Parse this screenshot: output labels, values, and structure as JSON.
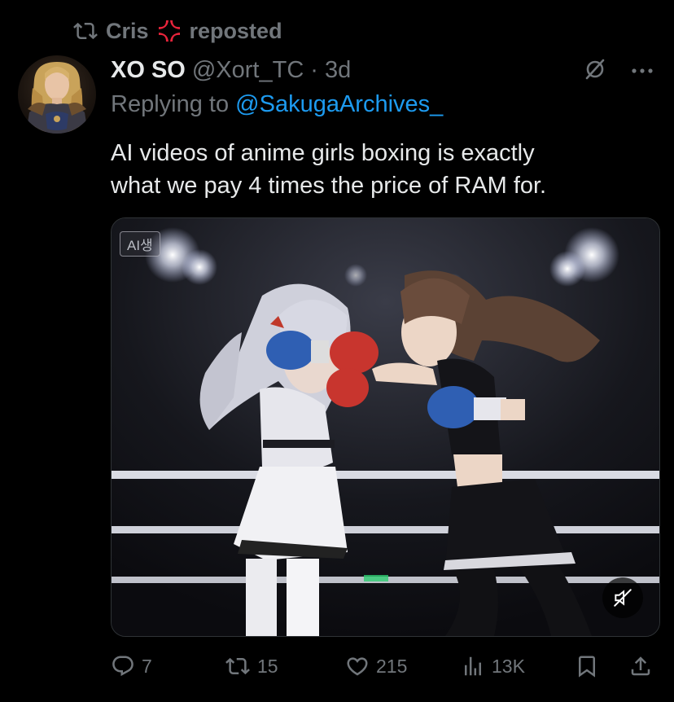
{
  "repost": {
    "user": "Cris",
    "label": "reposted",
    "emoji_icon": "anger-symbol-icon",
    "color": "#71767b"
  },
  "author": {
    "display_name": "XO SO",
    "handle": "@Xort_TC",
    "separator": "·",
    "time": "3d"
  },
  "reply": {
    "prefix": "Replying to ",
    "mention": "@SakugaArchives_",
    "mention_color": "#1d9bf0"
  },
  "text": {
    "line1": "AI videos of anime girls boxing is exactly",
    "line2": "what we pay 4 times the price of RAM for."
  },
  "media": {
    "badge": "AI생",
    "muted": true
  },
  "actions": {
    "replies": "7",
    "reposts": "15",
    "likes": "215",
    "views": "13K"
  },
  "colors": {
    "background": "#000000",
    "text": "#e7e9ea",
    "muted": "#71767b",
    "accent": "#1d9bf0"
  }
}
